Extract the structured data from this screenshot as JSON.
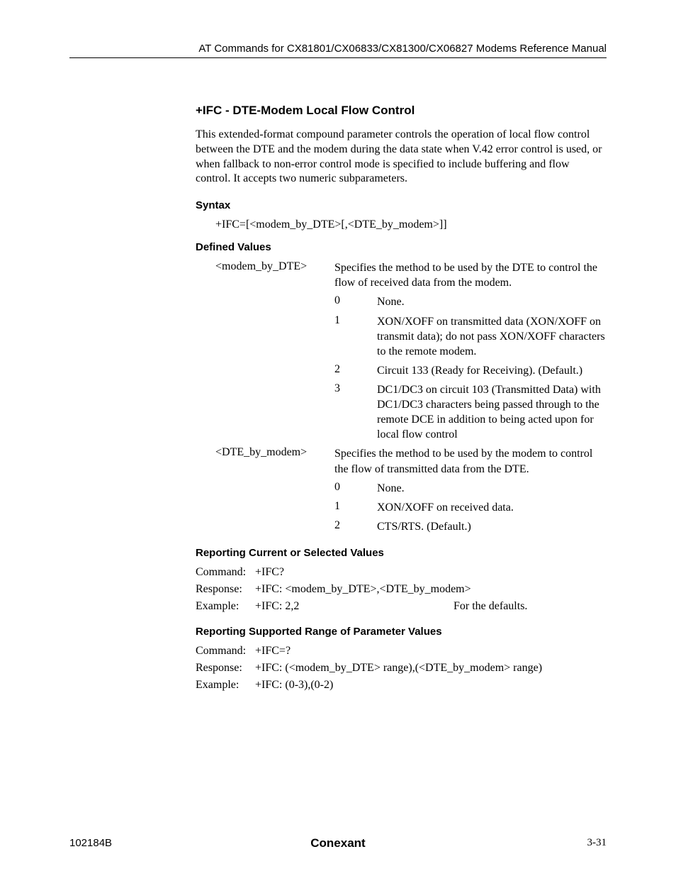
{
  "header": "AT Commands for CX81801/CX06833/CX81300/CX06827 Modems Reference Manual",
  "title": "+IFC - DTE-Modem Local Flow Control",
  "intro": "This extended-format compound parameter controls the operation of local flow control between the DTE and the modem during the data state when V.42 error control is used, or when fallback to non-error control mode is specified to include buffering and flow control. It accepts two numeric subparameters.",
  "syntax": {
    "heading": "Syntax",
    "text": "+IFC=[<modem_by_DTE>[,<DTE_by_modem>]]"
  },
  "defined": {
    "heading": "Defined Values",
    "params": [
      {
        "name": "<modem_by_DTE>",
        "desc": "Specifies the method to be used by the DTE to control the flow of received data from the modem.",
        "values": [
          {
            "n": "0",
            "d": "None."
          },
          {
            "n": "1",
            "d": "XON/XOFF on transmitted data (XON/XOFF on transmit data); do not pass XON/XOFF characters to the remote modem."
          },
          {
            "n": "2",
            "d": "Circuit 133 (Ready for Receiving). (Default.)"
          },
          {
            "n": "3",
            "d": "DC1/DC3 on circuit 103 (Transmitted Data) with DC1/DC3 characters being passed through to the remote DCE in addition to being acted upon for local flow control"
          }
        ]
      },
      {
        "name": "<DTE_by_modem>",
        "desc": "Specifies the method to be used by the modem to control the flow of transmitted data from the DTE.",
        "values": [
          {
            "n": "0",
            "d": "None."
          },
          {
            "n": "1",
            "d": "XON/XOFF on received data."
          },
          {
            "n": "2",
            "d": "CTS/RTS. (Default.)"
          }
        ]
      }
    ]
  },
  "reporting_current": {
    "heading": "Reporting Current or Selected Values",
    "rows": [
      {
        "k": "Command:",
        "v": "+IFC?"
      },
      {
        "k": "Response:",
        "v": "+IFC: <modem_by_DTE>,<DTE_by_modem>"
      },
      {
        "k": "Example:",
        "v": "+IFC: 2,2",
        "note": "For the defaults."
      }
    ]
  },
  "reporting_range": {
    "heading": "Reporting Supported Range of Parameter Values",
    "rows": [
      {
        "k": "Command:",
        "v": "+IFC=?"
      },
      {
        "k": "Response:",
        "v": "+IFC: (<modem_by_DTE> range),(<DTE_by_modem> range)"
      },
      {
        "k": "Example:",
        "v": "+IFC: (0-3),(0-2)"
      }
    ]
  },
  "footer": {
    "left": "102184B",
    "center": "Conexant",
    "right": "3-31"
  }
}
